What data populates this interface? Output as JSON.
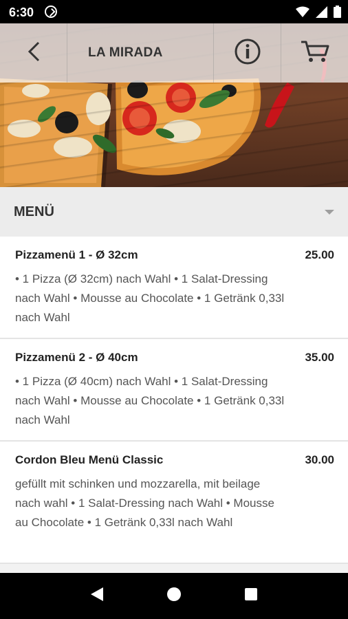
{
  "status_bar": {
    "time": "6:30"
  },
  "header": {
    "title": "LA MIRADA"
  },
  "menu": {
    "heading": "MENÜ"
  },
  "items": [
    {
      "name": "Pizzamenü 1 - Ø 32cm",
      "price": "25.00",
      "description": "• 1 Pizza (Ø 32cm) nach Wahl • 1 Salat-Dressing nach Wahl • Mousse au Chocolate • 1 Getränk 0,33l nach Wahl"
    },
    {
      "name": "Pizzamenü 2 - Ø 40cm",
      "price": "35.00",
      "description": "• 1 Pizza (Ø 40cm) nach Wahl • 1 Salat-Dressing nach Wahl • Mousse au Chocolate • 1 Getränk 0,33l nach Wahl"
    },
    {
      "name": "Cordon Bleu Menü Classic",
      "price": "30.00",
      "description": "gefüllt mit schinken und mozzarella, mit beilage nach wahl • 1 Salat-Dressing nach Wahl • Mousse au Chocolate • 1 Getränk 0,33l nach Wahl"
    }
  ],
  "icons": {
    "back": "chevron-left-icon",
    "info": "info-icon",
    "cart": "cart-icon",
    "nav_back": "triangle-back-icon",
    "nav_home": "circle-home-icon",
    "nav_recents": "square-recents-icon"
  },
  "colors": {
    "status_bar": "#000000",
    "nav_bar": "#000000",
    "pepper_red": "#c8141a"
  }
}
